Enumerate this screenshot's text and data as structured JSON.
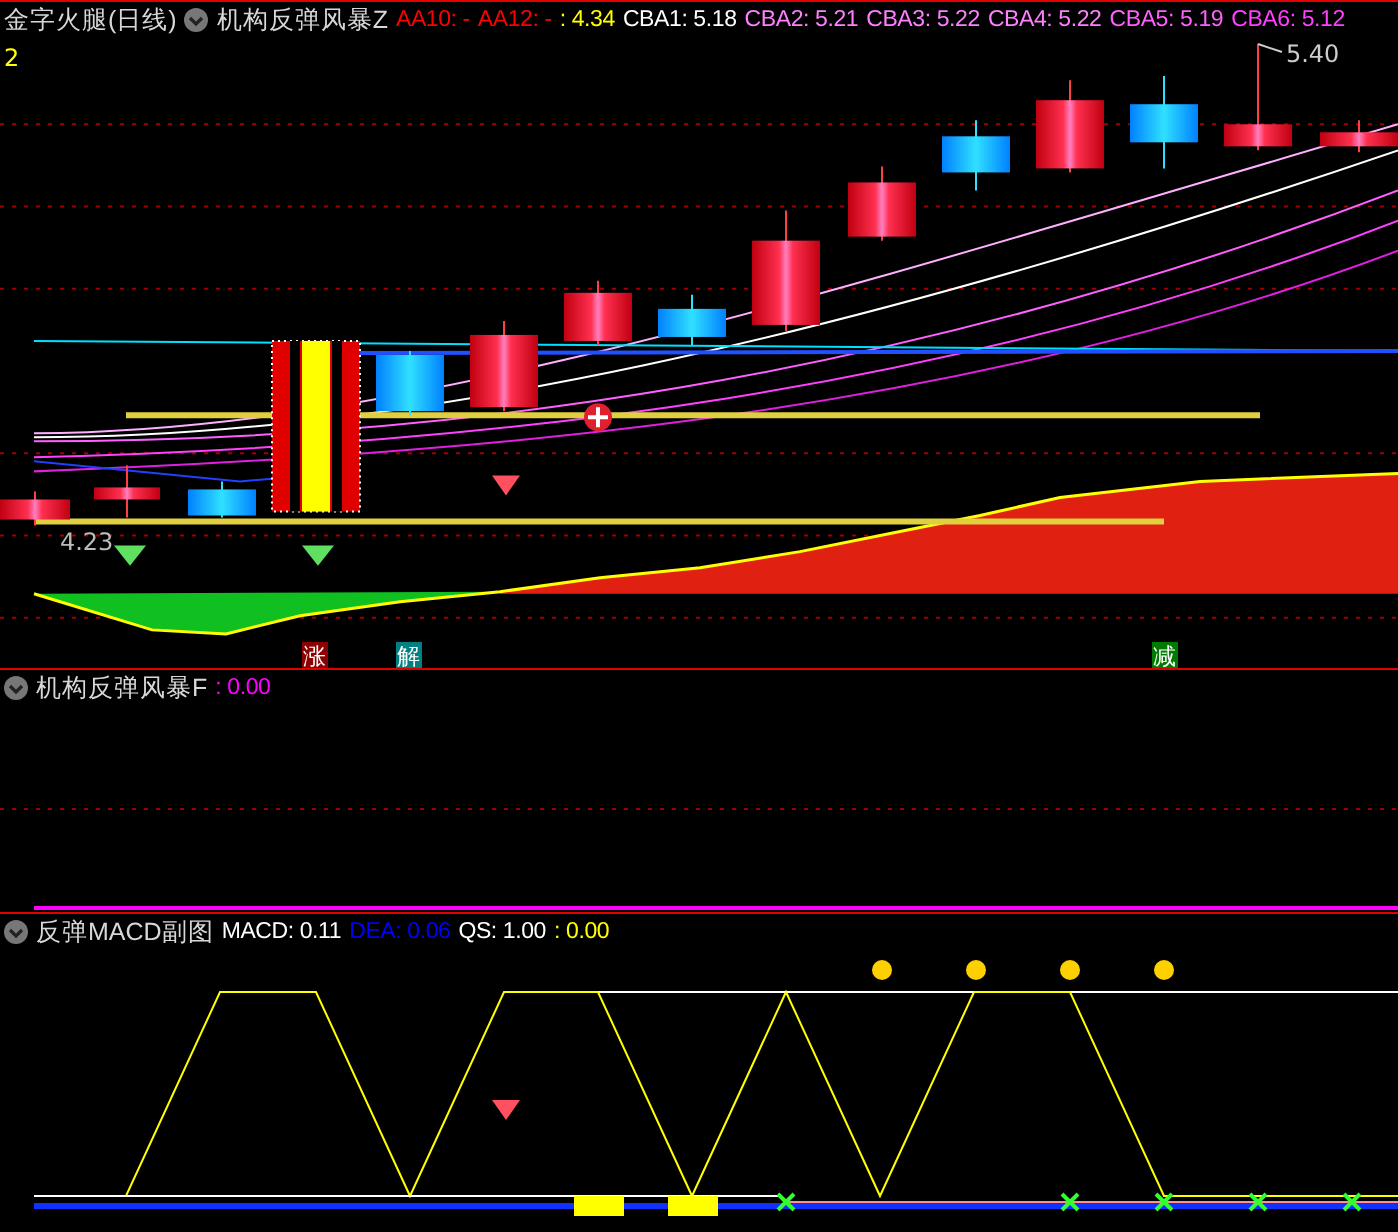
{
  "main_panel": {
    "title": "金字火腿(日线)",
    "indicator": "机构反弹风暴Z",
    "values": [
      {
        "text": "AA10: -",
        "color": "#ff0000"
      },
      {
        "text": "AA12: -",
        "color": "#ff0000"
      },
      {
        "text": ": 4.34",
        "color": "#ffff00"
      },
      {
        "text": "CBA1: 5.18",
        "color": "#ffffff"
      },
      {
        "text": "CBA2: 5.21",
        "color": "#ff80ff"
      },
      {
        "text": "CBA3: 5.22",
        "color": "#ff80ff"
      },
      {
        "text": "CBA4: 5.22",
        "color": "#ff80ff"
      },
      {
        "text": "CBA5: 5.19",
        "color": "#ff60ff"
      },
      {
        "text": "CBA6: 5.12",
        "color": "#ff40ff"
      }
    ],
    "corner_label": "2",
    "high_label": "5.40",
    "low_label": "4.23",
    "signals": [
      {
        "text": "涨",
        "color": "#8b0000"
      },
      {
        "text": "解",
        "color": "#008080"
      },
      {
        "text": "减",
        "color": "#007a00"
      }
    ]
  },
  "second_panel": {
    "indicator": "机构反弹风暴F",
    "values": [
      {
        "text": ": 0.00",
        "color": "#ff00ff"
      }
    ]
  },
  "macd_panel": {
    "indicator": "反弹MACD副图",
    "values": [
      {
        "text": "MACD: 0.11",
        "color": "#ffffff"
      },
      {
        "text": "DEA: 0.06",
        "color": "#0000ff"
      },
      {
        "text": "QS: 1.00",
        "color": "#ffffff"
      },
      {
        "text": ": 0.00",
        "color": "#ffff00"
      }
    ]
  }
}
